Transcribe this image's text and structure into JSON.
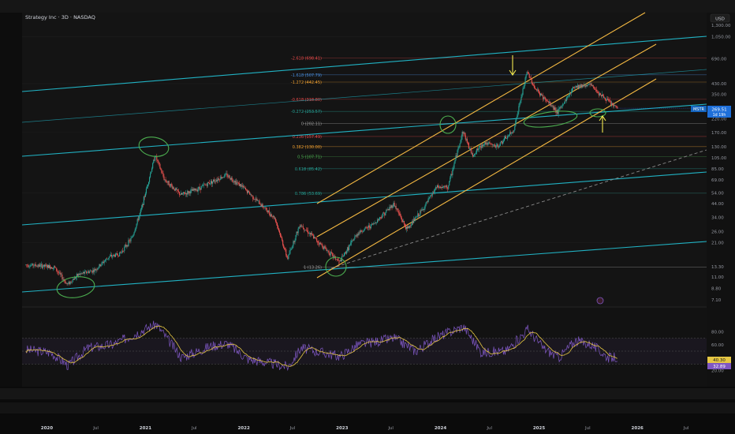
{
  "header": {
    "symbol_title": "Strategy Inc · 3D · NASDAQ",
    "currency": "USD"
  },
  "price_scale": {
    "labels": [
      "1,300.00",
      "1,050.00",
      "690.00",
      "430.00",
      "350.00",
      "220.00",
      "170.00",
      "130.00",
      "105.00",
      "85.00",
      "69.00",
      "54.00",
      "44.00",
      "34.00",
      "26.00",
      "21.00",
      "13.30",
      "11.00",
      "8.80",
      "7.10"
    ]
  },
  "last_price": {
    "ticker": "MSTR",
    "price": "269.51",
    "countdown": "1d 19h"
  },
  "fib_levels": [
    {
      "label": "-2.618 (698.41)",
      "color": "#e84a4a"
    },
    {
      "label": "-1.618 (507.79)",
      "color": "#4a90e2"
    },
    {
      "label": "-1.272 (442.45)",
      "color": "#f0a030"
    },
    {
      "label": "-0.618 (318.80)",
      "color": "#e84a4a"
    },
    {
      "label": "-0.272 (253.57)",
      "color": "#26a69a"
    },
    {
      "label": "0 (202.11)",
      "color": "#9e9e9e"
    },
    {
      "label": "0.236 (157.49)",
      "color": "#e84a4a"
    },
    {
      "label": "0.382 (130.00)",
      "color": "#f0a030"
    },
    {
      "label": "0.5 (107.71)",
      "color": "#4caf50"
    },
    {
      "label": "0.618 (85.42)",
      "color": "#26a69a"
    },
    {
      "label": "0.786 (53.69)",
      "color": "#26a69a"
    },
    {
      "label": "1 (13.26)",
      "color": "#9e9e9e"
    }
  ],
  "rsi_scale": {
    "labels": [
      "80.00",
      "60.00",
      "20.00"
    ],
    "rsi_value": "40.30",
    "ma_value": "32.89"
  },
  "time_axis": {
    "labels": [
      "2020",
      "Jul",
      "2021",
      "Jul",
      "2022",
      "Jul",
      "2023",
      "Jul",
      "2024",
      "Jul",
      "2025",
      "Jul",
      "2026",
      "Jul"
    ]
  },
  "colors": {
    "candle_up": "#26a69a",
    "candle_down": "#ef5350",
    "channel_cyan": "#22c3d6",
    "channel_orange": "#f5b942",
    "annotation_green": "#4caf50",
    "annotation_yellow": "#f2e94e",
    "rsi_line": "#7e57c2",
    "rsi_ma": "#e5c643"
  },
  "chart_data": {
    "type": "candlestick",
    "title": "Strategy Inc · 3D · NASDAQ",
    "y_scale": "log",
    "ylim": [
      7.1,
      1300
    ],
    "x_range": [
      "2019-10",
      "2026-09"
    ],
    "series": [
      {
        "name": "MSTR",
        "points": [
          [
            "2019-10-15",
            13.8
          ],
          [
            "2019-12-01",
            13.6
          ],
          [
            "2020-02-01",
            13.2
          ],
          [
            "2020-03-20",
            9.5
          ],
          [
            "2020-05-01",
            11.5
          ],
          [
            "2020-07-01",
            12.5
          ],
          [
            "2020-08-20",
            16
          ],
          [
            "2020-10-01",
            17
          ],
          [
            "2020-11-15",
            23
          ],
          [
            "2020-12-20",
            40
          ],
          [
            "2021-01-20",
            75
          ],
          [
            "2021-02-09",
            110
          ],
          [
            "2021-03-15",
            70
          ],
          [
            "2021-05-15",
            52
          ],
          [
            "2021-07-15",
            58
          ],
          [
            "2021-09-01",
            66
          ],
          [
            "2021-11-01",
            76
          ],
          [
            "2022-01-01",
            60
          ],
          [
            "2022-03-01",
            45
          ],
          [
            "2022-05-01",
            33
          ],
          [
            "2022-06-15",
            15.5
          ],
          [
            "2022-08-01",
            30
          ],
          [
            "2022-10-01",
            22
          ],
          [
            "2022-12-25",
            14.5
          ],
          [
            "2023-03-01",
            25
          ],
          [
            "2023-05-01",
            30
          ],
          [
            "2023-07-15",
            44
          ],
          [
            "2023-09-01",
            27
          ],
          [
            "2023-11-01",
            40
          ],
          [
            "2023-12-20",
            60
          ],
          [
            "2024-02-01",
            60
          ],
          [
            "2024-03-27",
            175
          ],
          [
            "2024-05-01",
            110
          ],
          [
            "2024-06-15",
            140
          ],
          [
            "2024-08-01",
            130
          ],
          [
            "2024-10-01",
            175
          ],
          [
            "2024-11-21",
            540
          ],
          [
            "2024-12-20",
            390
          ],
          [
            "2025-02-01",
            310
          ],
          [
            "2025-03-15",
            250
          ],
          [
            "2025-05-15",
            410
          ],
          [
            "2025-07-15",
            420
          ],
          [
            "2025-09-01",
            330
          ],
          [
            "2025-10-20",
            269.51
          ]
        ]
      },
      {
        "name": "RSI",
        "ylim": [
          0,
          100
        ],
        "points": [
          [
            "2019-10-15",
            52
          ],
          [
            "2020-01-15",
            48
          ],
          [
            "2020-03-20",
            28
          ],
          [
            "2020-06-01",
            55
          ],
          [
            "2020-09-01",
            60
          ],
          [
            "2020-12-20",
            82
          ],
          [
            "2021-02-09",
            92
          ],
          [
            "2021-05-15",
            40
          ],
          [
            "2021-09-01",
            58
          ],
          [
            "2021-11-01",
            62
          ],
          [
            "2022-01-15",
            38
          ],
          [
            "2022-06-15",
            26
          ],
          [
            "2022-08-01",
            55
          ],
          [
            "2022-12-25",
            42
          ],
          [
            "2023-03-01",
            60
          ],
          [
            "2023-07-15",
            70
          ],
          [
            "2023-10-01",
            50
          ],
          [
            "2023-12-20",
            72
          ],
          [
            "2024-03-27",
            88
          ],
          [
            "2024-06-01",
            48
          ],
          [
            "2024-09-01",
            50
          ],
          [
            "2024-11-21",
            84
          ],
          [
            "2025-01-15",
            55
          ],
          [
            "2025-03-15",
            40
          ],
          [
            "2025-05-15",
            66
          ],
          [
            "2025-07-15",
            60
          ],
          [
            "2025-09-15",
            40
          ],
          [
            "2025-10-20",
            40.3
          ]
        ]
      }
    ]
  }
}
